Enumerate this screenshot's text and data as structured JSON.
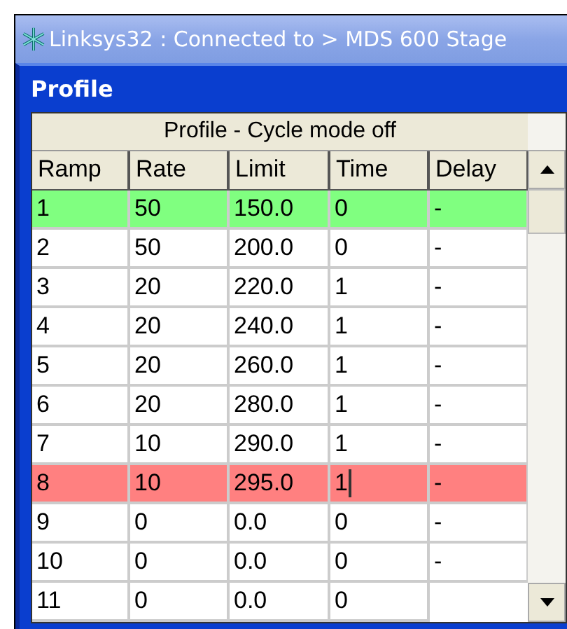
{
  "window": {
    "title": "Linksys32 : Connected to >  MDS 600  Stage"
  },
  "panel": {
    "title": "Profile"
  },
  "table": {
    "caption": "Profile - Cycle mode off",
    "columns": [
      "Ramp",
      "Rate",
      "Limit",
      "Time",
      "Delay"
    ],
    "rows": [
      {
        "cells": [
          "1",
          "50",
          "150.0",
          "0",
          "-"
        ],
        "color": "#80ff80",
        "editing": false
      },
      {
        "cells": [
          "2",
          "50",
          "200.0",
          "0",
          "-"
        ],
        "editing": false
      },
      {
        "cells": [
          "3",
          "20",
          "220.0",
          "1",
          "-"
        ],
        "editing": false
      },
      {
        "cells": [
          "4",
          "20",
          "240.0",
          "1",
          "-"
        ],
        "editing": false
      },
      {
        "cells": [
          "5",
          "20",
          "260.0",
          "1",
          "-"
        ],
        "editing": false
      },
      {
        "cells": [
          "6",
          "20",
          "280.0",
          "1",
          "-"
        ],
        "editing": false
      },
      {
        "cells": [
          "7",
          "10",
          "290.0",
          "1",
          "-"
        ],
        "editing": false
      },
      {
        "cells": [
          "8",
          "10",
          "295.0",
          "1",
          "-"
        ],
        "color": "#ff8080",
        "editing": true
      },
      {
        "cells": [
          "9",
          "0",
          "0.0",
          "0",
          "-"
        ],
        "editing": false
      },
      {
        "cells": [
          "10",
          "0",
          "0.0",
          "0",
          "-"
        ],
        "editing": false
      },
      {
        "cells": [
          "11",
          "0",
          "0.0",
          "0"
        ],
        "editing": false
      }
    ]
  }
}
